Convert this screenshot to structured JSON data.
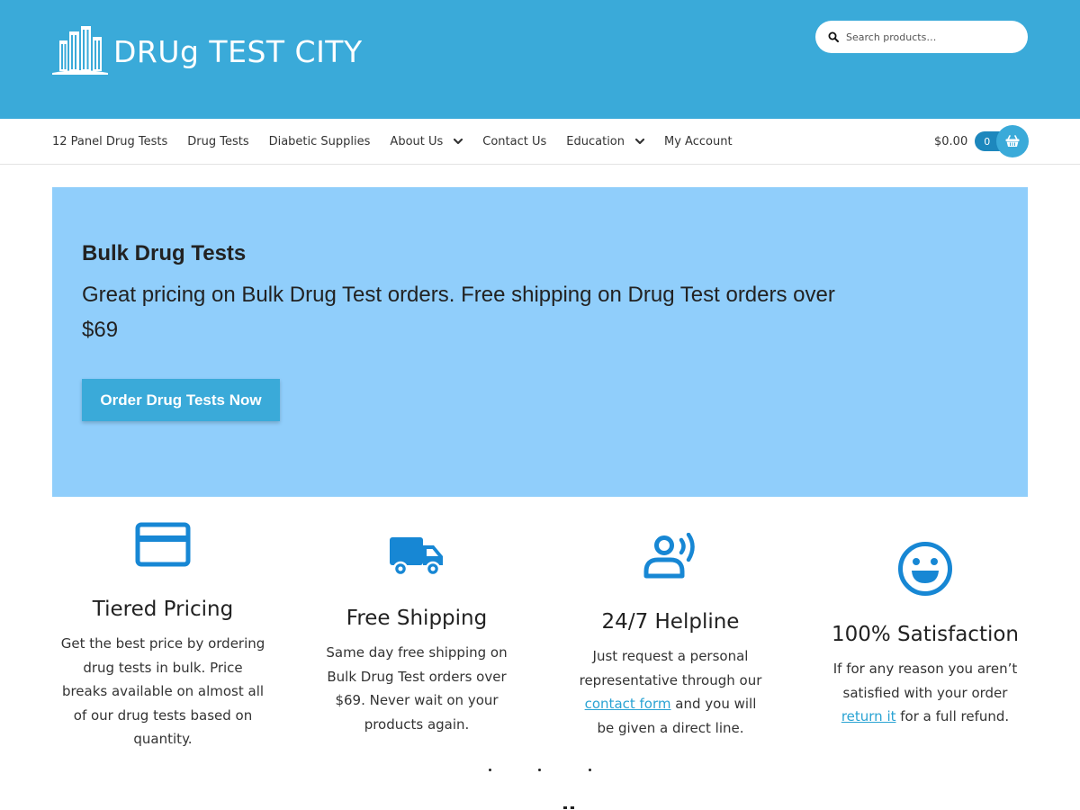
{
  "header": {
    "logo_text": "DRUg TEST CITY",
    "search_placeholder": "Search products…",
    "bg_color": "#3aaad9"
  },
  "nav": {
    "items": [
      {
        "label": "12 Panel Drug Tests",
        "has_dropdown": false
      },
      {
        "label": "Drug Tests",
        "has_dropdown": false
      },
      {
        "label": "Diabetic Supplies",
        "has_dropdown": false
      },
      {
        "label": "About Us",
        "has_dropdown": true
      },
      {
        "label": "Contact Us",
        "has_dropdown": false
      },
      {
        "label": "Education",
        "has_dropdown": true
      },
      {
        "label": "My Account",
        "has_dropdown": false
      }
    ],
    "cart_total": "$0.00",
    "cart_count": "0"
  },
  "hero": {
    "title": "Bulk Drug Tests",
    "subtitle": "Great pricing on Bulk Drug Test orders. Free shipping on Drug Test orders over $69",
    "button_label": "Order Drug Tests Now",
    "bg_color": "#90cefb"
  },
  "features": [
    {
      "icon": "credit-card-icon",
      "title": "Tiered Pricing",
      "text": "Get the best price by ordering drug tests in bulk. Price breaks available on almost all of our drug tests based on quantity."
    },
    {
      "icon": "truck-icon",
      "title": "Free Shipping",
      "text": "Same day free shipping on Bulk Drug Test orders over $69. Never wait on your products again."
    },
    {
      "icon": "helpline-icon",
      "title": "24/7 Helpline",
      "text_before": "Just request a personal representative through our",
      "link": "contact form",
      "text_after": "and you will be given a direct line."
    },
    {
      "icon": "smiley-icon",
      "title": "100% Satisfaction",
      "text_before": "If for any reason you aren’t satisfied with your order",
      "link": "return it",
      "text_after": "for a full refund."
    }
  ],
  "colors": {
    "accent": "#3aaad9",
    "icon_blue": "#1787d4",
    "link": "#2aa3d3"
  }
}
